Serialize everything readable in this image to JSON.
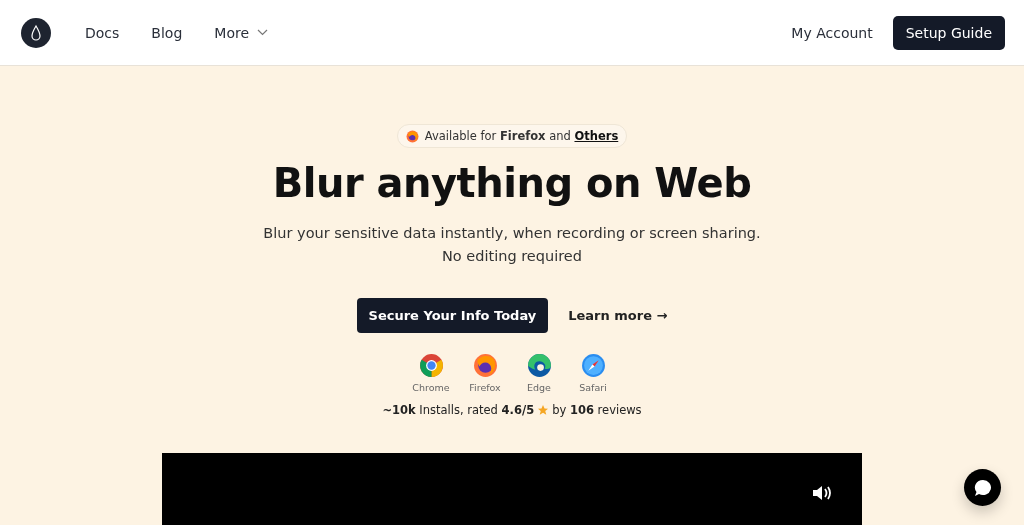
{
  "nav": {
    "links": [
      {
        "label": "Docs"
      },
      {
        "label": "Blog"
      },
      {
        "label": "More",
        "kind": "dropdown"
      }
    ],
    "account": "My Account",
    "cta": "Setup Guide"
  },
  "hero": {
    "badge": "Available for **Firefox** and ",
    "badge_link": "Others",
    "title": "Blur anything on Web",
    "subtitle": [
      "Blur your sensitive data instantly, when recording or screen sharing.",
      "No editing required"
    ],
    "primary": "Secure Your Info Today",
    "secondary": "Learn more →",
    "browsers": [
      {
        "name": "Chrome",
        "kind": "chrome"
      },
      {
        "name": "Firefox",
        "kind": "firefox"
      },
      {
        "name": "Edge",
        "kind": "edge"
      },
      {
        "name": "Safari",
        "kind": "safari"
      }
    ],
    "rating_before": "**~10k** Installs, rated **4.6/5**",
    "rating_after": "by **106** reviews"
  }
}
